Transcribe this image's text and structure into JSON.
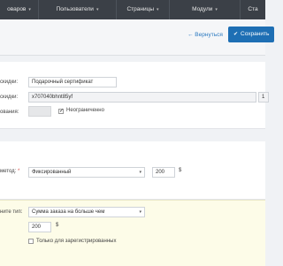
{
  "nav": {
    "items": [
      {
        "label": "оваров"
      },
      {
        "label": "Пользователи"
      },
      {
        "label": "Страницы"
      },
      {
        "label": "Модули"
      },
      {
        "label": "Ста"
      }
    ]
  },
  "actions": {
    "back_label": "← Вернуться",
    "save_label": "Сохранить"
  },
  "form": {
    "name": {
      "label": "скидки:",
      "value": "Подарочный сертификат"
    },
    "code": {
      "label": "скидки:",
      "value": "x707040bhnt85yf",
      "side_value": "1"
    },
    "usage": {
      "label": "ования:",
      "value": "",
      "checkbox_label": "Неограниченно",
      "checked": true
    },
    "method": {
      "label": "метод:",
      "required_mark": "*",
      "value": "Фиксированный",
      "amount": "200",
      "currency": "$"
    },
    "condition": {
      "label": "ните тип:",
      "value": "Сумма заказа на больше чем",
      "amount": "200",
      "currency": "$",
      "cut_text": "Только для зарегистрированных"
    }
  }
}
